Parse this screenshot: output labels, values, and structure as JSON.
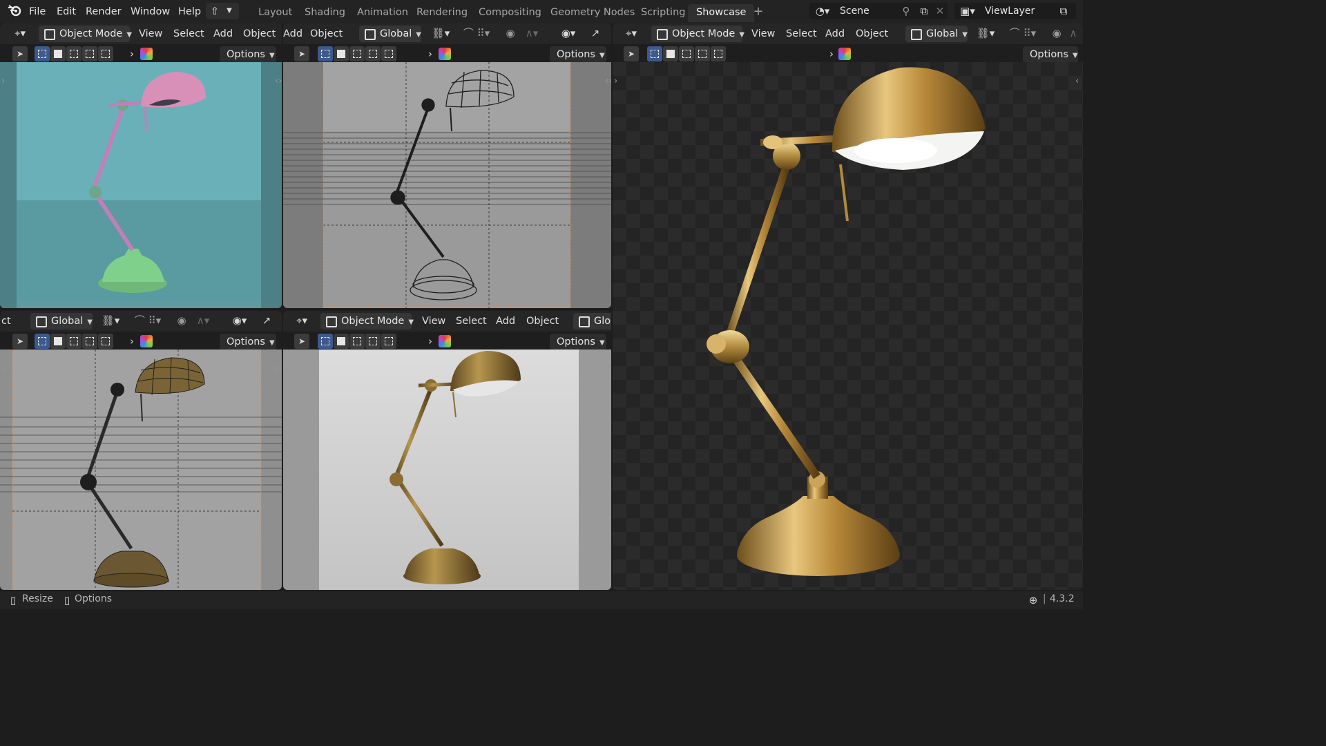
{
  "menu": [
    "File",
    "Edit",
    "Render",
    "Window",
    "Help"
  ],
  "workspaces": [
    "Layout",
    "Shading",
    "Animation",
    "Rendering",
    "Compositing",
    "Geometry Nodes",
    "Scripting",
    "Showcase"
  ],
  "active_workspace": "Showcase",
  "scene": {
    "label": "Scene"
  },
  "view_layer": {
    "label": "ViewLayer"
  },
  "viewport_header": {
    "mode": "Object Mode",
    "view": "View",
    "select": "Select",
    "add": "Add",
    "object": "Object",
    "orientation": "Global",
    "options": "Options"
  },
  "partial_labels": {
    "object_tail": "ct",
    "add_tail": "dd",
    "orientation_tail": "Glo"
  },
  "statusbar": {
    "resize": "Resize",
    "options": "Options",
    "version": "4.3.2"
  },
  "colors": {
    "accent": "#4772b3",
    "active_tab": "#303030",
    "brass": "#b08a3e"
  },
  "icons": [
    "blender-logo",
    "export-icon",
    "scene-icon",
    "pin-icon",
    "new-scene-icon",
    "delete-icon",
    "viewlayer-icon",
    "globe-icon",
    "mouse-icon"
  ]
}
